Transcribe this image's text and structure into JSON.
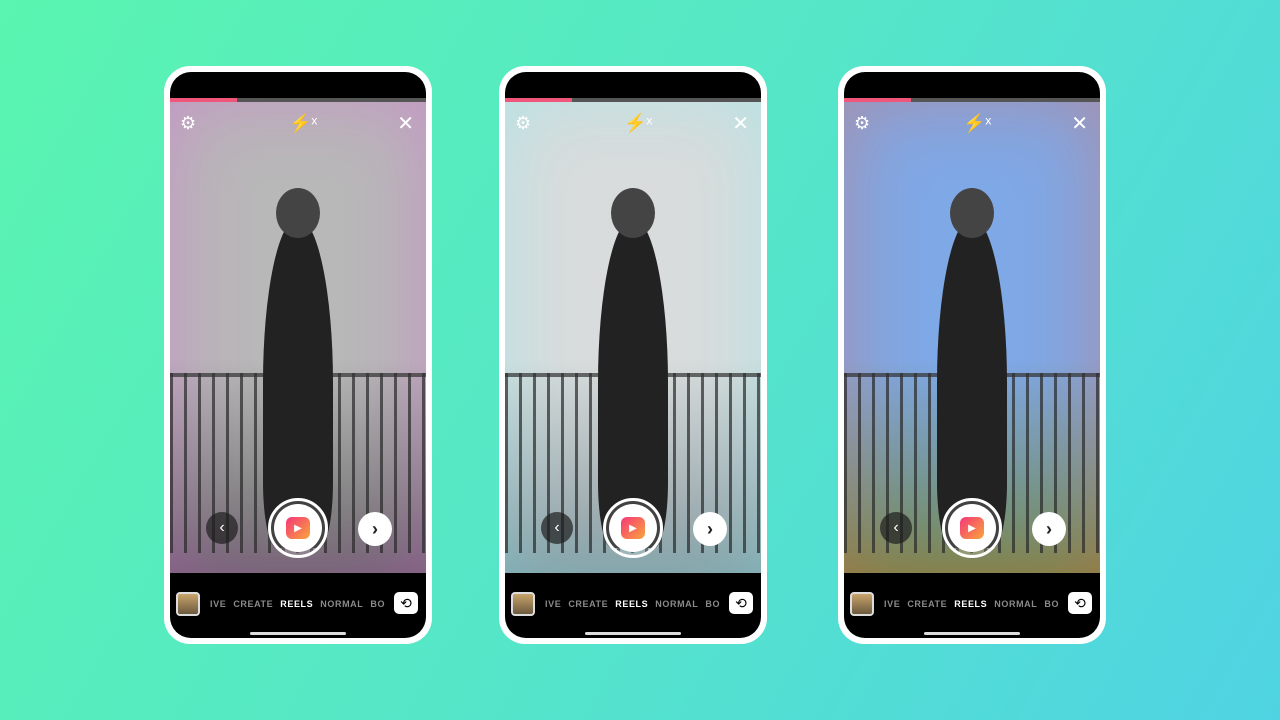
{
  "phones": [
    {
      "style": "multicolor echo effect, grayscale",
      "sky": "#b8b8b8",
      "ground": "#6a6a6a",
      "accent": "#e24ce0"
    },
    {
      "style": "grayscale with cyan glow",
      "sky": "#d9dcdc",
      "ground": "#8a9aa0",
      "accent": "#6ff0f5"
    },
    {
      "style": "color with fire effect",
      "sky": "#7fa8e6",
      "ground": "#6f8a55",
      "accent": "#ff5a2a"
    }
  ],
  "ui": {
    "settings_icon": "⚙",
    "flash_icon": "⚡ˣ",
    "close_icon": "✕",
    "back_icon": "‹",
    "next_icon": "›",
    "flip_icon": "⟲",
    "reels_icon": "▶",
    "modes": [
      "IVE",
      "CREATE",
      "REELS",
      "NORMAL",
      "BO"
    ],
    "active_mode": "REELS",
    "progress": 0.26,
    "progress_color": "#f0567a"
  }
}
